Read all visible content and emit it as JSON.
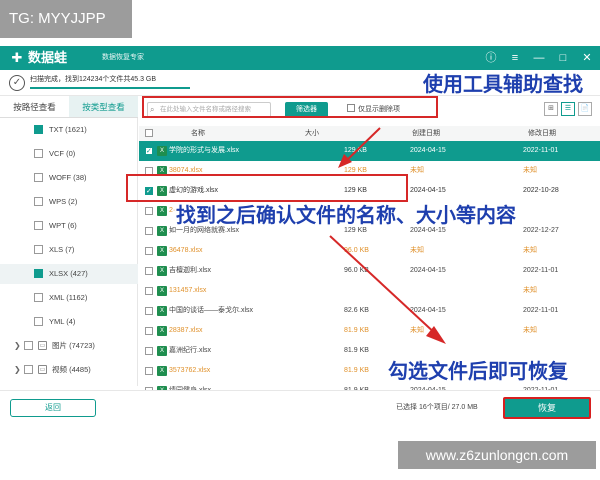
{
  "watermark_tl": "TG: MYYJJPP",
  "watermark_br": "www.z6zunlongcn.com",
  "app": {
    "name": "数据蛙",
    "subtitle": "数据恢复专家",
    "window_buttons": [
      "ⓘ",
      "≡",
      "—",
      "□",
      "✕"
    ]
  },
  "scan": {
    "text": "扫描完成，找到124234个文件共45.3 GB",
    "progress": 1.0
  },
  "tabs": [
    {
      "label": "按路径查看",
      "active": false
    },
    {
      "label": "按类型查看",
      "active": true
    }
  ],
  "sidebar": [
    {
      "label": "TXT (1621)",
      "checked": true
    },
    {
      "label": "VCF (0)",
      "checked": false
    },
    {
      "label": "WOFF (38)",
      "checked": false
    },
    {
      "label": "WPS (2)",
      "checked": false
    },
    {
      "label": "WPT (6)",
      "checked": false
    },
    {
      "label": "XLS (7)",
      "checked": false
    },
    {
      "label": "XLSX (427)",
      "checked": true,
      "selected": true
    },
    {
      "label": "XML (1162)",
      "checked": false
    },
    {
      "label": "YML (4)",
      "checked": false
    },
    {
      "label": "图片 (74723)",
      "group": true
    },
    {
      "label": "视频 (4485)",
      "group": true
    }
  ],
  "search": {
    "placeholder": "在此处输入文件名称或路径搜索"
  },
  "filter_label": "筛选器",
  "only_deleted_label": "仅显示删除项",
  "view_icons": [
    "⊞",
    "☰",
    "📄"
  ],
  "columns": {
    "name": "名称",
    "size": "大小",
    "created": "创建日期",
    "modified": "修改日期"
  },
  "rows": [
    {
      "name": "学院的形式与发展.xlsx",
      "size": "129 KB",
      "created": "2024-04-15",
      "modified": "2022-11-01",
      "checked": true,
      "state": "sel"
    },
    {
      "name": "38074.xlsx",
      "size": "129 KB",
      "created": "未知",
      "modified": "未知",
      "checked": false,
      "state": "orange"
    },
    {
      "name": "虚幻的游戏.xlsx",
      "size": "129 KB",
      "created": "2024-04-15",
      "modified": "2022-10-28",
      "checked": true,
      "state": "hi"
    },
    {
      "name": "2···",
      "size": "",
      "created": "",
      "modified": "",
      "checked": false,
      "state": "orange"
    },
    {
      "name": "如一月的网络就赛.xlsx",
      "size": "129 KB",
      "created": "2024-04-15",
      "modified": "2022-12-27",
      "checked": false,
      "state": ""
    },
    {
      "name": "36478.xlsx",
      "size": "96.0 KB",
      "created": "未知",
      "modified": "未知",
      "checked": false,
      "state": "orange"
    },
    {
      "name": "吉檀迦利.xlsx",
      "size": "96.0 KB",
      "created": "2024-04-15",
      "modified": "2022-11-01",
      "checked": false,
      "state": ""
    },
    {
      "name": "131457.xlsx",
      "size": "",
      "created": "",
      "modified": "未知",
      "checked": false,
      "state": "orange"
    },
    {
      "name": "中国的谈话——泰戈尔.xlsx",
      "size": "82.6 KB",
      "created": "2024-04-15",
      "modified": "2022-11-01",
      "checked": false,
      "state": ""
    },
    {
      "name": "28387.xlsx",
      "size": "81.9 KB",
      "created": "未知",
      "modified": "未知",
      "checked": false,
      "state": "orange"
    },
    {
      "name": "嘉洲纪行.xlsx",
      "size": "81.9 KB",
      "created": "",
      "modified": "",
      "checked": false,
      "state": ""
    },
    {
      "name": "3573762.xlsx",
      "size": "81.9 KB",
      "created": "",
      "modified": "",
      "checked": false,
      "state": "orange"
    },
    {
      "name": "绩园健身.xlsx",
      "size": "81.9 KB",
      "created": "2024-04-15",
      "modified": "2022-11-01",
      "checked": false,
      "state": ""
    }
  ],
  "bottom": {
    "back": "返回",
    "selected_info": "已选择 16个项目/ 27.0 MB",
    "recover": "恢复"
  },
  "annotations": {
    "a1": "使用工具辅助查找",
    "a2": "找到之后确认文件的名称、大小等内容",
    "a3": "勾选文件后即可恢复"
  },
  "colors": {
    "brand": "#0f9b8e",
    "annotation": "#1e3fae",
    "highlight_box": "#d62828",
    "orange_text": "#e0912b"
  }
}
